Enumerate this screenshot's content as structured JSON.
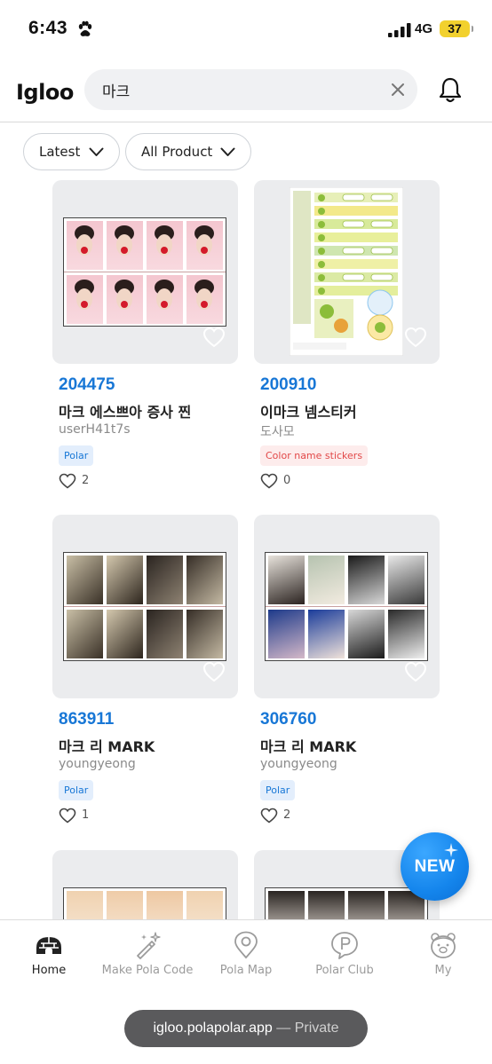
{
  "status_bar": {
    "time": "6:43",
    "network": "4G",
    "battery": "37"
  },
  "header": {
    "logo": "Igloo",
    "search": {
      "value": "마크",
      "placeholder": ""
    }
  },
  "filters": {
    "sort_label": "Latest",
    "product_label": "All Product"
  },
  "products": [
    {
      "code": "204475",
      "title": "마크 에스쁘아 증사 찐",
      "author": "userH41t7s",
      "badge": "Polar",
      "badge_style": "blue",
      "likes": "2"
    },
    {
      "code": "200910",
      "title": "이마크 넴스티커",
      "author": "도사모",
      "badge": "Color name stickers",
      "badge_style": "red",
      "likes": "0"
    },
    {
      "code": "863911",
      "title": "마크 리 MARK",
      "author": "youngyeong",
      "badge": "Polar",
      "badge_style": "blue",
      "likes": "1"
    },
    {
      "code": "306760",
      "title": "마크 리 MARK",
      "author": "youngyeong",
      "badge": "Polar",
      "badge_style": "blue",
      "likes": "2"
    }
  ],
  "fab": {
    "label": "NEW"
  },
  "bottom_nav": {
    "items": [
      {
        "label": "Home",
        "icon": "igloo-icon",
        "active": true
      },
      {
        "label": "Make Pola Code",
        "icon": "magic-wand-icon",
        "active": false
      },
      {
        "label": "Pola Map",
        "icon": "map-pin-icon",
        "active": false
      },
      {
        "label": "Polar Club",
        "icon": "p-badge-icon",
        "active": false
      },
      {
        "label": "My",
        "icon": "bear-face-icon",
        "active": false
      }
    ]
  },
  "browser": {
    "url": "igloo.polapolar.app",
    "mode": "— Private"
  },
  "colors": {
    "accent": "#1877d6",
    "badge_red": "#e24848",
    "fab_blue": "#1485ec"
  }
}
